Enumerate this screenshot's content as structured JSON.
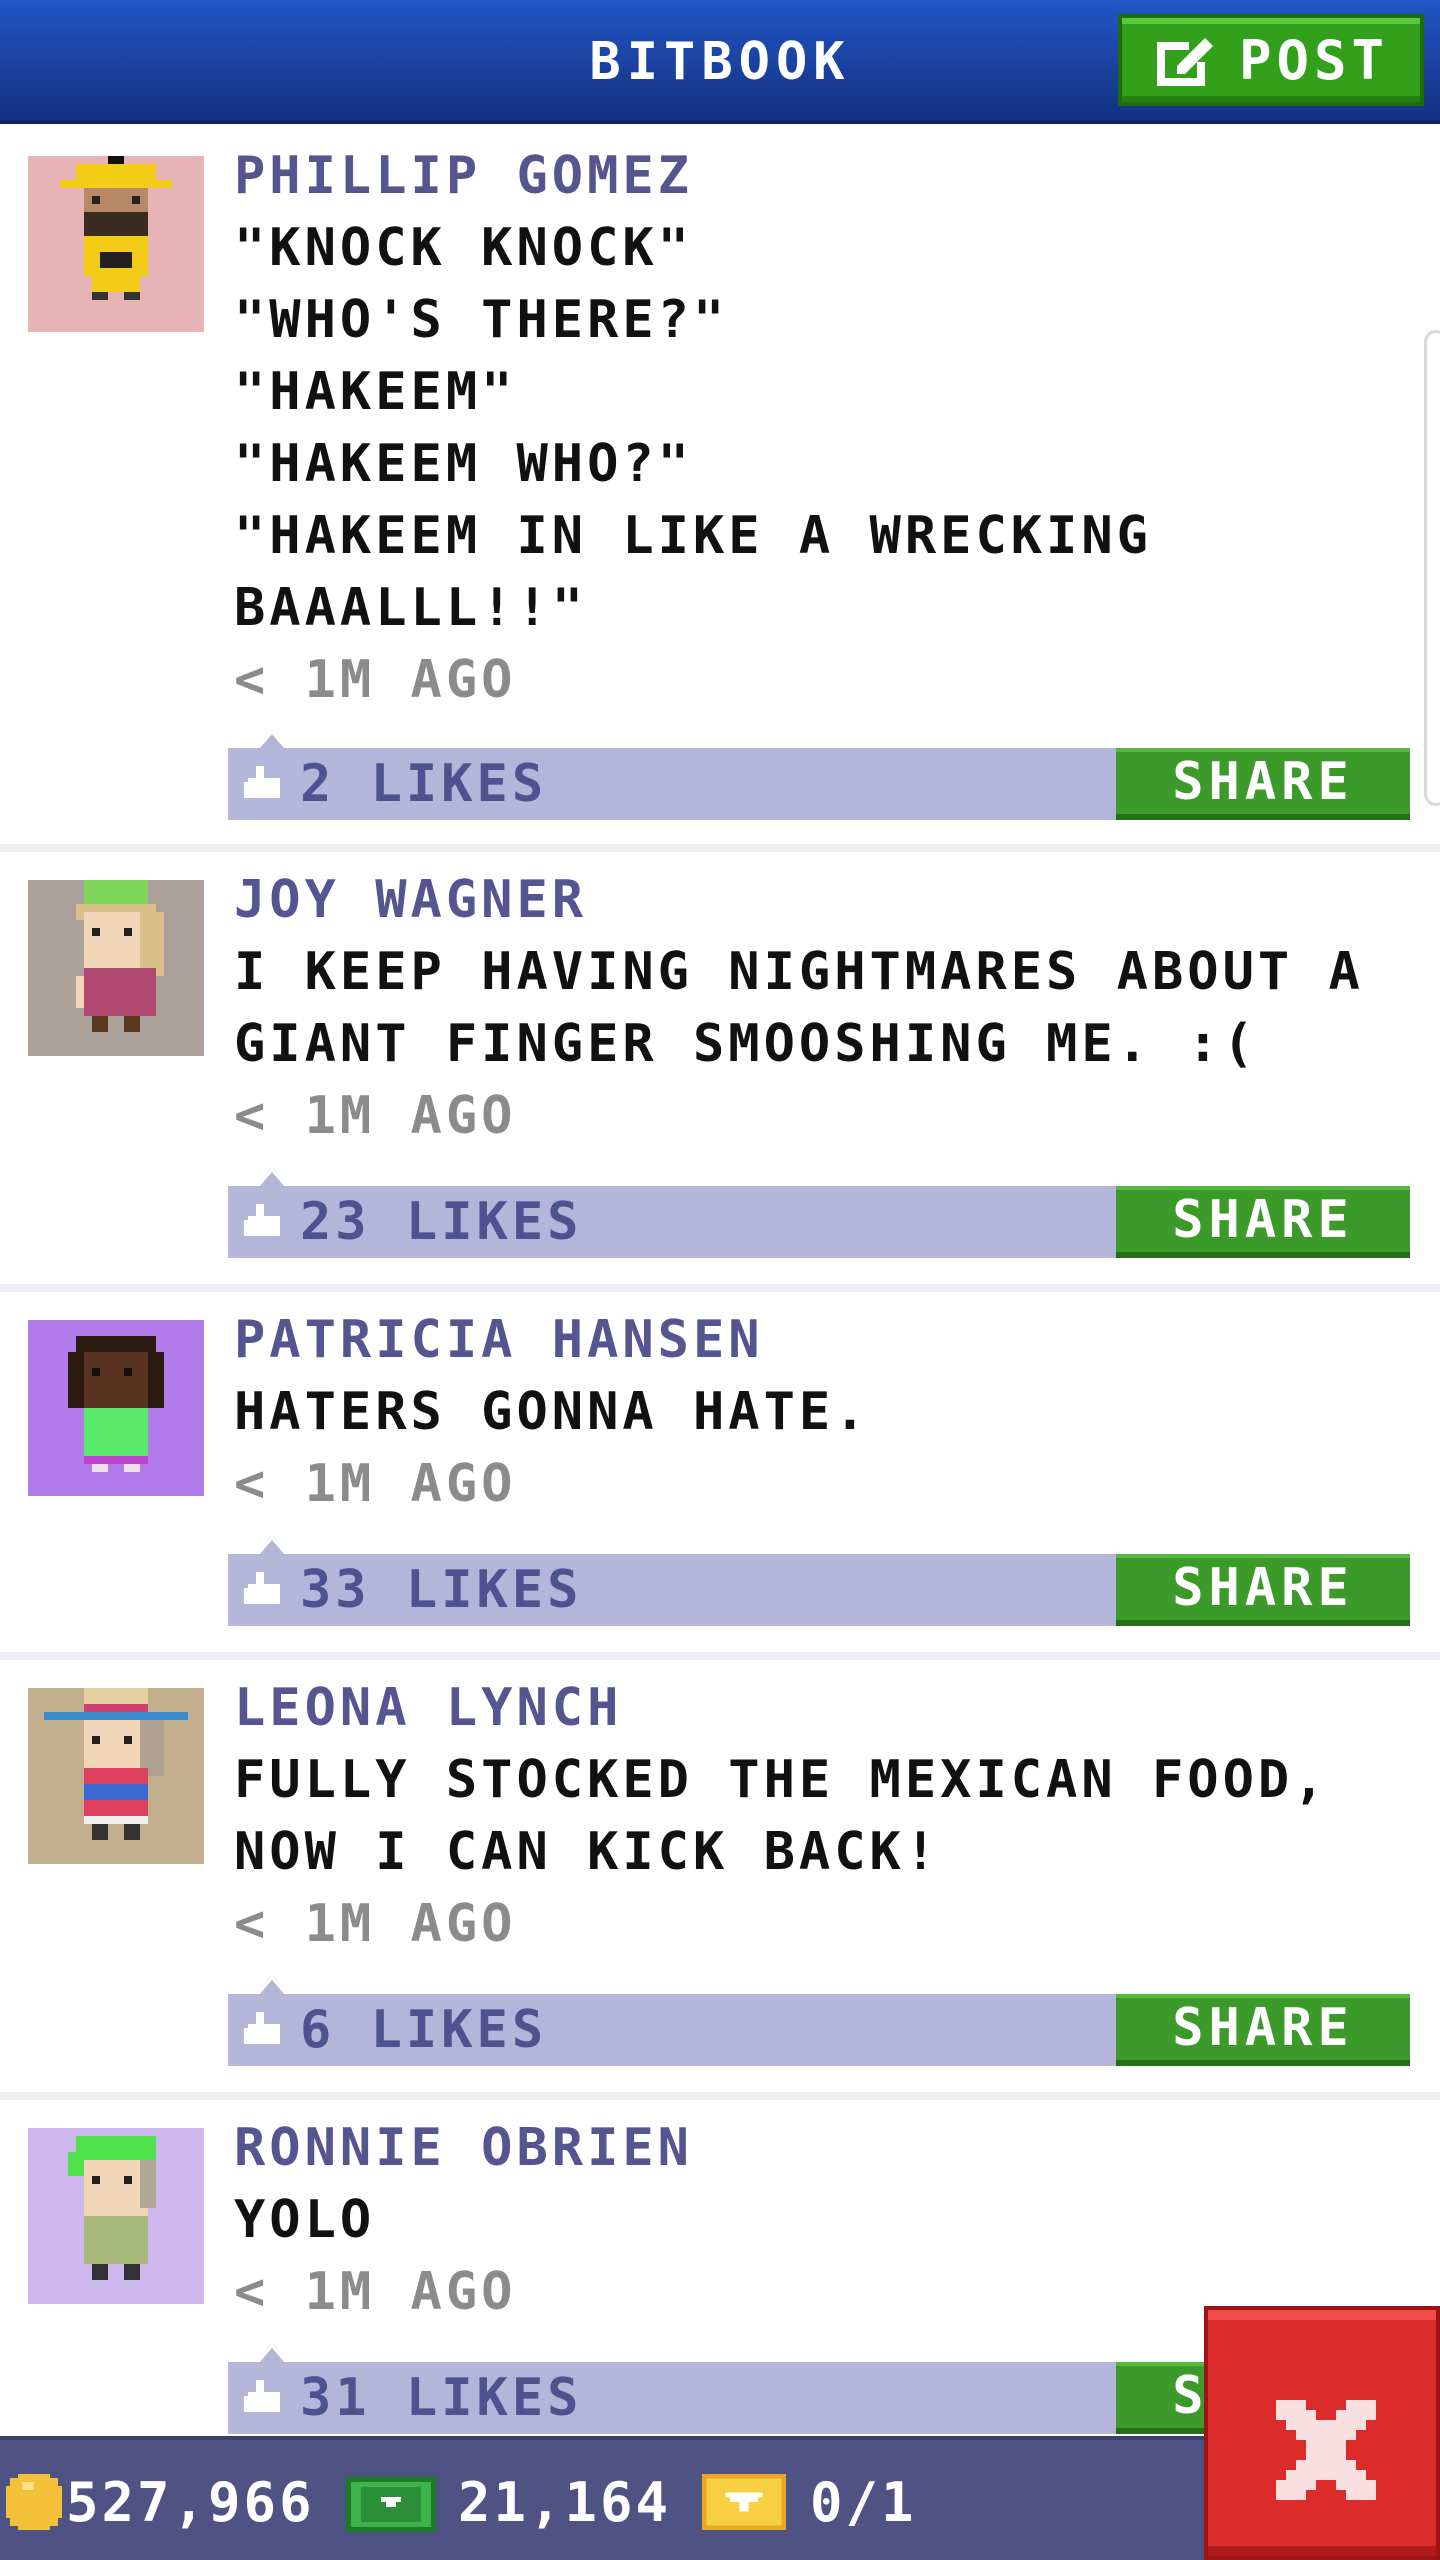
{
  "header": {
    "title": "BITBOOK",
    "post_label": "POST"
  },
  "posts": [
    {
      "name": "PHILLIP GOMEZ",
      "message": "\"KNOCK KNOCK\"\n\"WHO'S THERE?\"\n\"HAKEEM\"\n\"HAKEEM WHO?\"\n\"HAKEEM IN LIKE A WRECKING\nBAAALLL!!\"",
      "time": "< 1M AGO",
      "likes": "2 LIKES",
      "share_label": "SHARE",
      "avatar_bg": "#e8b3b5"
    },
    {
      "name": "JOY WAGNER",
      "message": "I KEEP HAVING NIGHTMARES ABOUT A\nGIANT FINGER SMOOSHING ME. :(",
      "time": "< 1M AGO",
      "likes": "23 LIKES",
      "share_label": "SHARE",
      "avatar_bg": "#aca09a"
    },
    {
      "name": "PATRICIA HANSEN",
      "message": "HATERS GONNA HATE.",
      "time": "< 1M AGO",
      "likes": "33 LIKES",
      "share_label": "SHARE",
      "avatar_bg": "#b07ae8"
    },
    {
      "name": "LEONA LYNCH",
      "message": "FULLY STOCKED THE MEXICAN FOOD,\nNOW I CAN KICK BACK!",
      "time": "< 1M AGO",
      "likes": "6 LIKES",
      "share_label": "SHARE",
      "avatar_bg": "#c3ae8e"
    },
    {
      "name": "RONNIE OBRIEN",
      "message": "YOLO",
      "time": "< 1M AGO",
      "likes": "31 LIKES",
      "share_label": "SHARE",
      "avatar_bg": "#cdb7ec"
    }
  ],
  "footer": {
    "coins": "527,966",
    "bux": "21,164",
    "tickets": "0/1"
  },
  "colors": {
    "header_blue": "#1d4bb5",
    "name_purple": "#55558f",
    "likes_bar": "#b3b6d8",
    "share_green": "#3b9a29",
    "close_red": "#dc2b2b",
    "footer_bg": "#4e5384"
  }
}
